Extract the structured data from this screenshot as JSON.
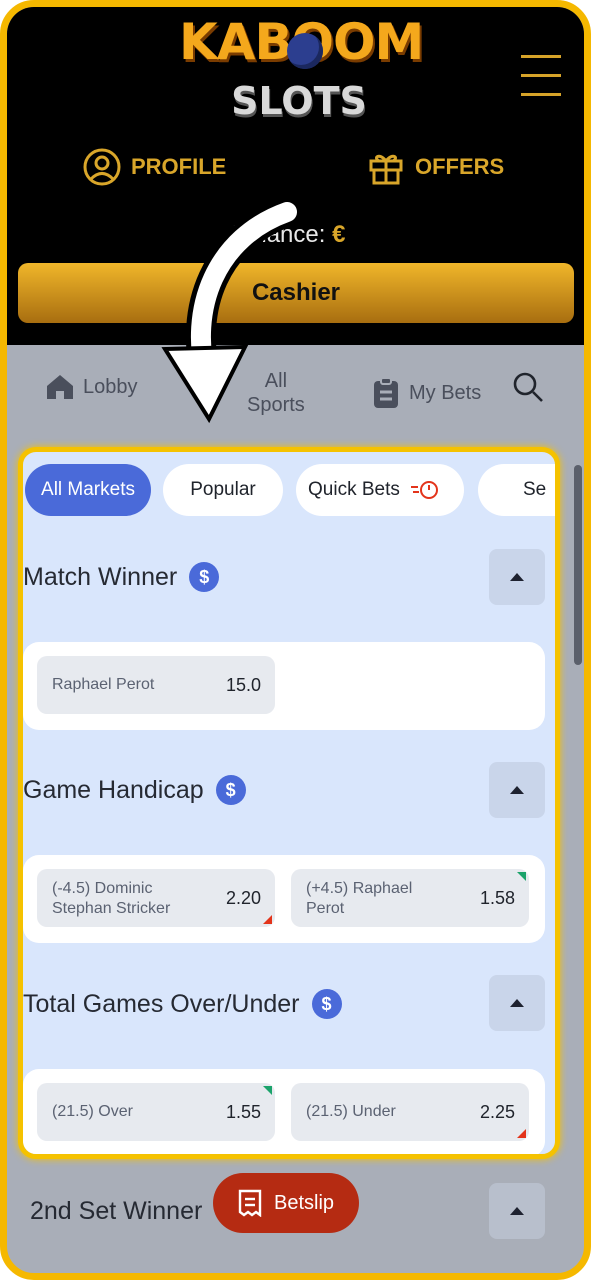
{
  "header": {
    "logo_top": "KABOOM",
    "logo_bottom": "SLOTS",
    "profile_label": "PROFILE",
    "offers_label": "OFFERS",
    "balance_label": "Balance:",
    "balance_currency": "€",
    "cashier_label": "Cashier"
  },
  "nav": {
    "lobby": "Lobby",
    "all_sports_line1": "All",
    "all_sports_line2": "Sports",
    "my_bets": "My Bets"
  },
  "chips": [
    {
      "label": "All Markets",
      "active": true
    },
    {
      "label": "Popular",
      "active": false
    },
    {
      "label": "Quick Bets",
      "active": false
    },
    {
      "label": "Se",
      "active": false
    }
  ],
  "markets": [
    {
      "title": "Match Winner",
      "odds": [
        {
          "label": "Raphael Perot",
          "value": "15.0"
        }
      ]
    },
    {
      "title": "Game Handicap",
      "odds": [
        {
          "label_line1": "(-4.5) Dominic",
          "label_line2": "Stephan Stricker",
          "value": "2.20",
          "trend": "down"
        },
        {
          "label_line1": "(+4.5) Raphael",
          "label_line2": "Perot",
          "value": "1.58",
          "trend": "up"
        }
      ]
    },
    {
      "title": "Total Games Over/Under",
      "odds": [
        {
          "label": "(21.5) Over",
          "value": "1.55",
          "trend": "up"
        },
        {
          "label": "(21.5) Under",
          "value": "2.25",
          "trend": "down"
        }
      ]
    },
    {
      "title": "2nd Set Winner"
    }
  ],
  "betslip_label": "Betslip",
  "colors": {
    "accent": "#4a6ad9",
    "gold": "#d9a62a",
    "frame": "#f5b800",
    "betslip": "#b52b12"
  }
}
